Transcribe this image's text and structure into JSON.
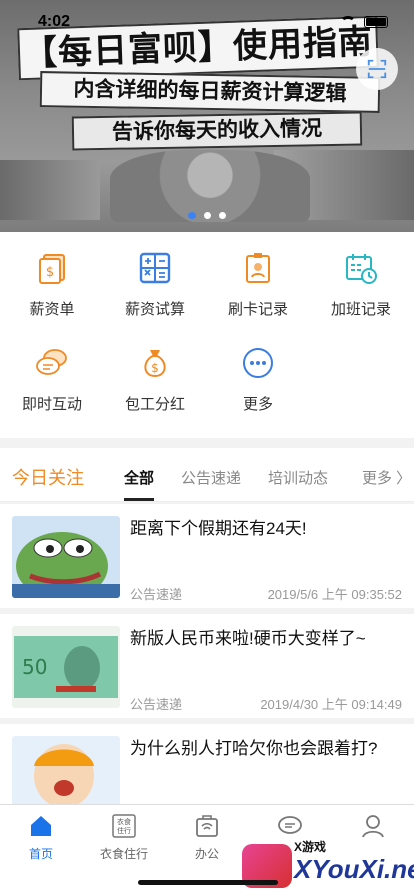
{
  "status": {
    "time": "4:02"
  },
  "banner": {
    "title": "【每日富呗】使用指南",
    "subtitle1": "内含详细的每日薪资计算逻辑",
    "subtitle2": "告诉你每天的收入情况",
    "page_count": 3,
    "active_page": 0
  },
  "menu": {
    "items": [
      {
        "label": "薪资单",
        "icon": "payslip-icon"
      },
      {
        "label": "薪资试算",
        "icon": "calculator-icon"
      },
      {
        "label": "刷卡记录",
        "icon": "punch-card-icon"
      },
      {
        "label": "加班记录",
        "icon": "overtime-calendar-icon"
      },
      {
        "label": "即时互动",
        "icon": "chat-bubbles-icon"
      },
      {
        "label": "包工分红",
        "icon": "money-bag-icon"
      },
      {
        "label": "更多",
        "icon": "more-icon"
      }
    ]
  },
  "focus": {
    "title": "今日关注",
    "tabs": [
      "全部",
      "公告速递",
      "培训动态"
    ],
    "more_label": "更多 〉"
  },
  "news": [
    {
      "title": "距离下个假期还有24天!",
      "source": "公告速递",
      "time": "2019/5/6 上午 09:35:52"
    },
    {
      "title": "新版人民币来啦!硬币大变样了~",
      "source": "公告速递",
      "time": "2019/4/30 上午 09:14:49"
    },
    {
      "title": "为什么别人打哈欠你也会跟着打?",
      "source": "",
      "time": ""
    }
  ],
  "tabbar": {
    "items": [
      {
        "label": "首页",
        "icon": "home-icon"
      },
      {
        "label": "衣食住行",
        "icon": "life-services-icon"
      },
      {
        "label": "办公",
        "icon": "office-icon"
      },
      {
        "label": "",
        "icon": "message-icon"
      },
      {
        "label": "",
        "icon": "profile-icon"
      }
    ],
    "home_icon_text": "衣食住行"
  },
  "watermark": {
    "brand": "X游戏",
    "site": "XYouXi.net"
  },
  "colors": {
    "accent": "#f08a24",
    "primary": "#1a73e8"
  }
}
